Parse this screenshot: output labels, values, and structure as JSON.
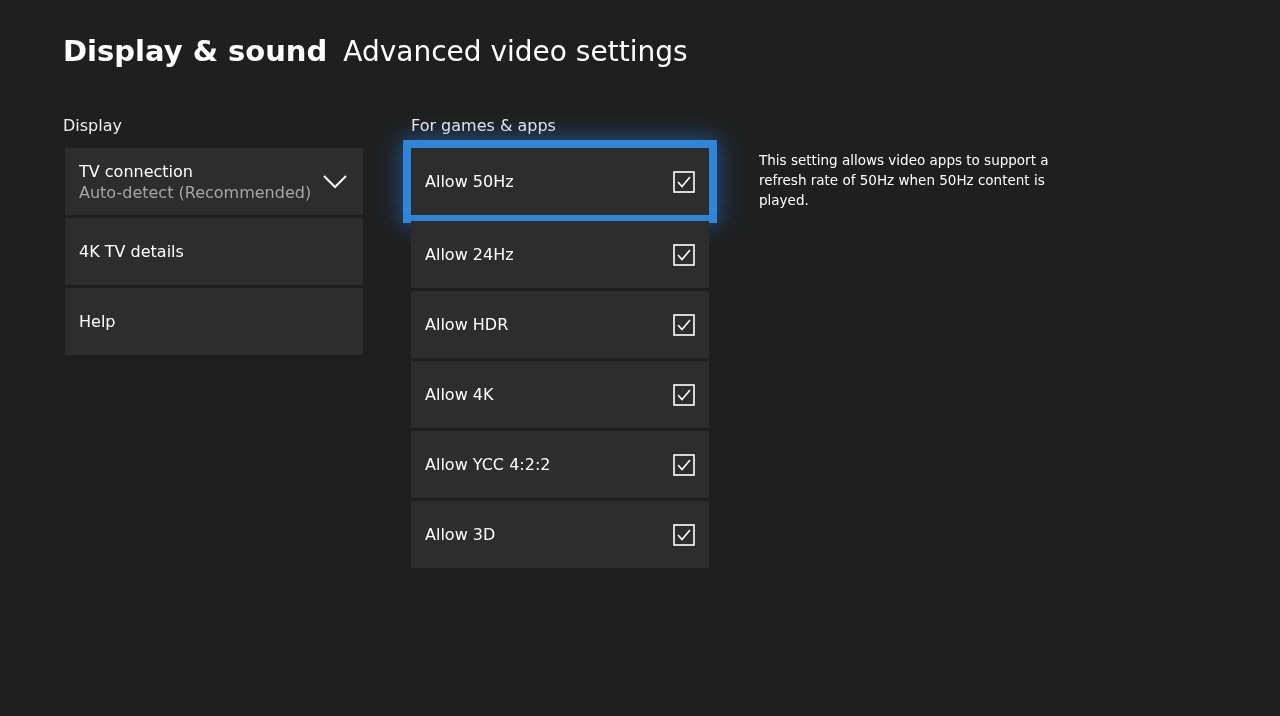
{
  "header": {
    "section": "Display & sound",
    "title": "Advanced video settings"
  },
  "display": {
    "heading": "Display",
    "items": [
      {
        "kind": "dropdown",
        "label": "TV connection",
        "value": "Auto-detect (Recommended)"
      },
      {
        "kind": "link",
        "label": "4K TV details"
      },
      {
        "kind": "link",
        "label": "Help"
      }
    ]
  },
  "games_apps": {
    "heading": "For games & apps",
    "options": [
      {
        "label": "Allow 50Hz",
        "checked": true,
        "selected": true
      },
      {
        "label": "Allow 24Hz",
        "checked": true,
        "selected": false
      },
      {
        "label": "Allow HDR",
        "checked": true,
        "selected": false
      },
      {
        "label": "Allow 4K",
        "checked": true,
        "selected": false
      },
      {
        "label": "Allow YCC 4:2:2",
        "checked": true,
        "selected": false
      },
      {
        "label": "Allow 3D",
        "checked": true,
        "selected": false
      }
    ]
  },
  "description": "This setting allows video apps to support a refresh rate of 50Hz when 50Hz content is played."
}
